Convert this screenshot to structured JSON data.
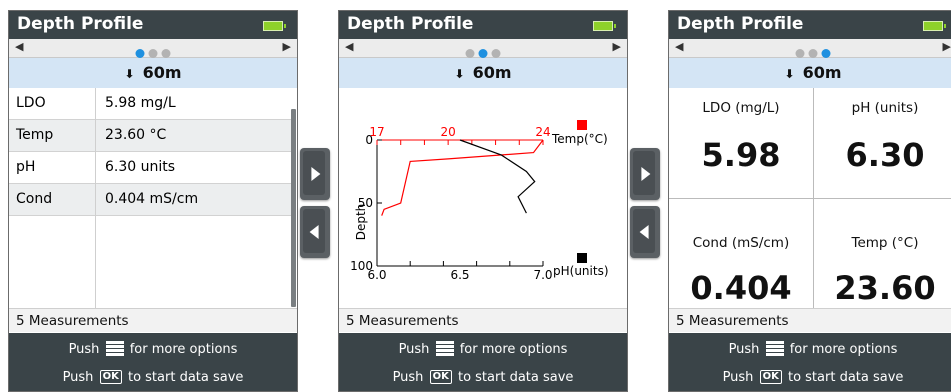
{
  "title": "Depth Profile",
  "depth": "60m",
  "footer": "5 Measurements",
  "bottom": {
    "line1_pre": "Push",
    "line1_post": "for more options",
    "line2_pre": "Push",
    "ok": "OK",
    "line2_post": "to start data save"
  },
  "nav": {
    "left_arrow": "◀",
    "right_arrow": "▶",
    "down_arrow": "⬇"
  },
  "screen1": {
    "rows": [
      {
        "label": "LDO",
        "value": "5.98 mg/L"
      },
      {
        "label": "Temp",
        "value": "23.60 °C"
      },
      {
        "label": "pH",
        "value": "6.30 units"
      },
      {
        "label": "Cond",
        "value": "0.404 mS/cm"
      }
    ]
  },
  "screen3": {
    "cells": [
      {
        "label": "LDO (mg/L)",
        "value": "5.98"
      },
      {
        "label": "pH (units)",
        "value": "6.30"
      },
      {
        "label": "Cond (mS/cm)",
        "value": "0.404"
      },
      {
        "label": "Temp (°C)",
        "value": "23.60"
      }
    ]
  },
  "colors": {
    "temp": "#ff0000",
    "ph": "#000000",
    "active_dot": "#1e90e0",
    "bar": "#3a4448",
    "depth_bar": "#d4e5f5"
  },
  "chart_data": {
    "type": "line",
    "ylabel": "Depth",
    "y_ticks": [
      "0",
      "50",
      "100"
    ],
    "ylim": [
      0,
      100
    ],
    "top_axis": {
      "ticks": [
        "17",
        "20",
        "24"
      ],
      "range": [
        17,
        24
      ]
    },
    "bottom_axis": {
      "ticks": [
        "6.0",
        "6.5",
        "7.0"
      ],
      "range": [
        6.0,
        7.0
      ]
    },
    "series": [
      {
        "name": "Temp(°C)",
        "axis": "top",
        "points": [
          [
            24,
            0
          ],
          [
            23.6,
            10
          ],
          [
            20,
            15
          ],
          [
            18.4,
            17
          ],
          [
            18,
            50
          ],
          [
            17.3,
            55
          ],
          [
            17.2,
            60
          ]
        ]
      },
      {
        "name": "pH(units)",
        "axis": "bottom",
        "points": [
          [
            6.5,
            0
          ],
          [
            6.75,
            12
          ],
          [
            6.9,
            25
          ],
          [
            6.95,
            33
          ],
          [
            6.85,
            45
          ],
          [
            6.9,
            58
          ]
        ]
      }
    ]
  }
}
